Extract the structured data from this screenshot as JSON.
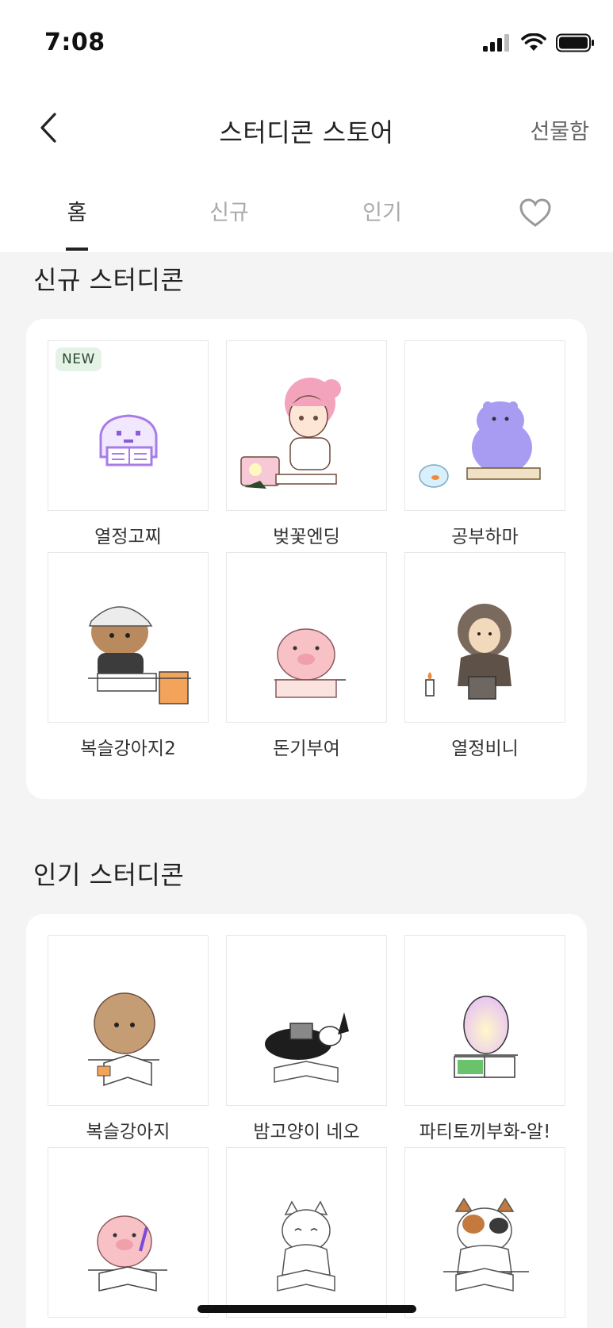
{
  "status_bar": {
    "time": "7:08"
  },
  "nav": {
    "title": "스터디콘 스토어",
    "gift_label": "선물함"
  },
  "tabs": [
    {
      "label": "홈",
      "active": true
    },
    {
      "label": "신규",
      "active": false
    },
    {
      "label": "인기",
      "active": false
    }
  ],
  "sections": {
    "new": {
      "title": "신규 스터디콘",
      "badge": "NEW",
      "items": [
        "열정고찌",
        "벚꽃엔딩",
        "공부하마",
        "복슬강아지2",
        "돈기부여",
        "열정비니"
      ]
    },
    "popular": {
      "title": "인기 스터디콘",
      "items": [
        "복슬강아지",
        "밤고양이 네오",
        "파티토끼부화-알!",
        "",
        "",
        ""
      ]
    }
  },
  "colors": {
    "accent": "#222222",
    "new_badge_bg": "#e5f2e6",
    "background": "#f4f4f5"
  }
}
